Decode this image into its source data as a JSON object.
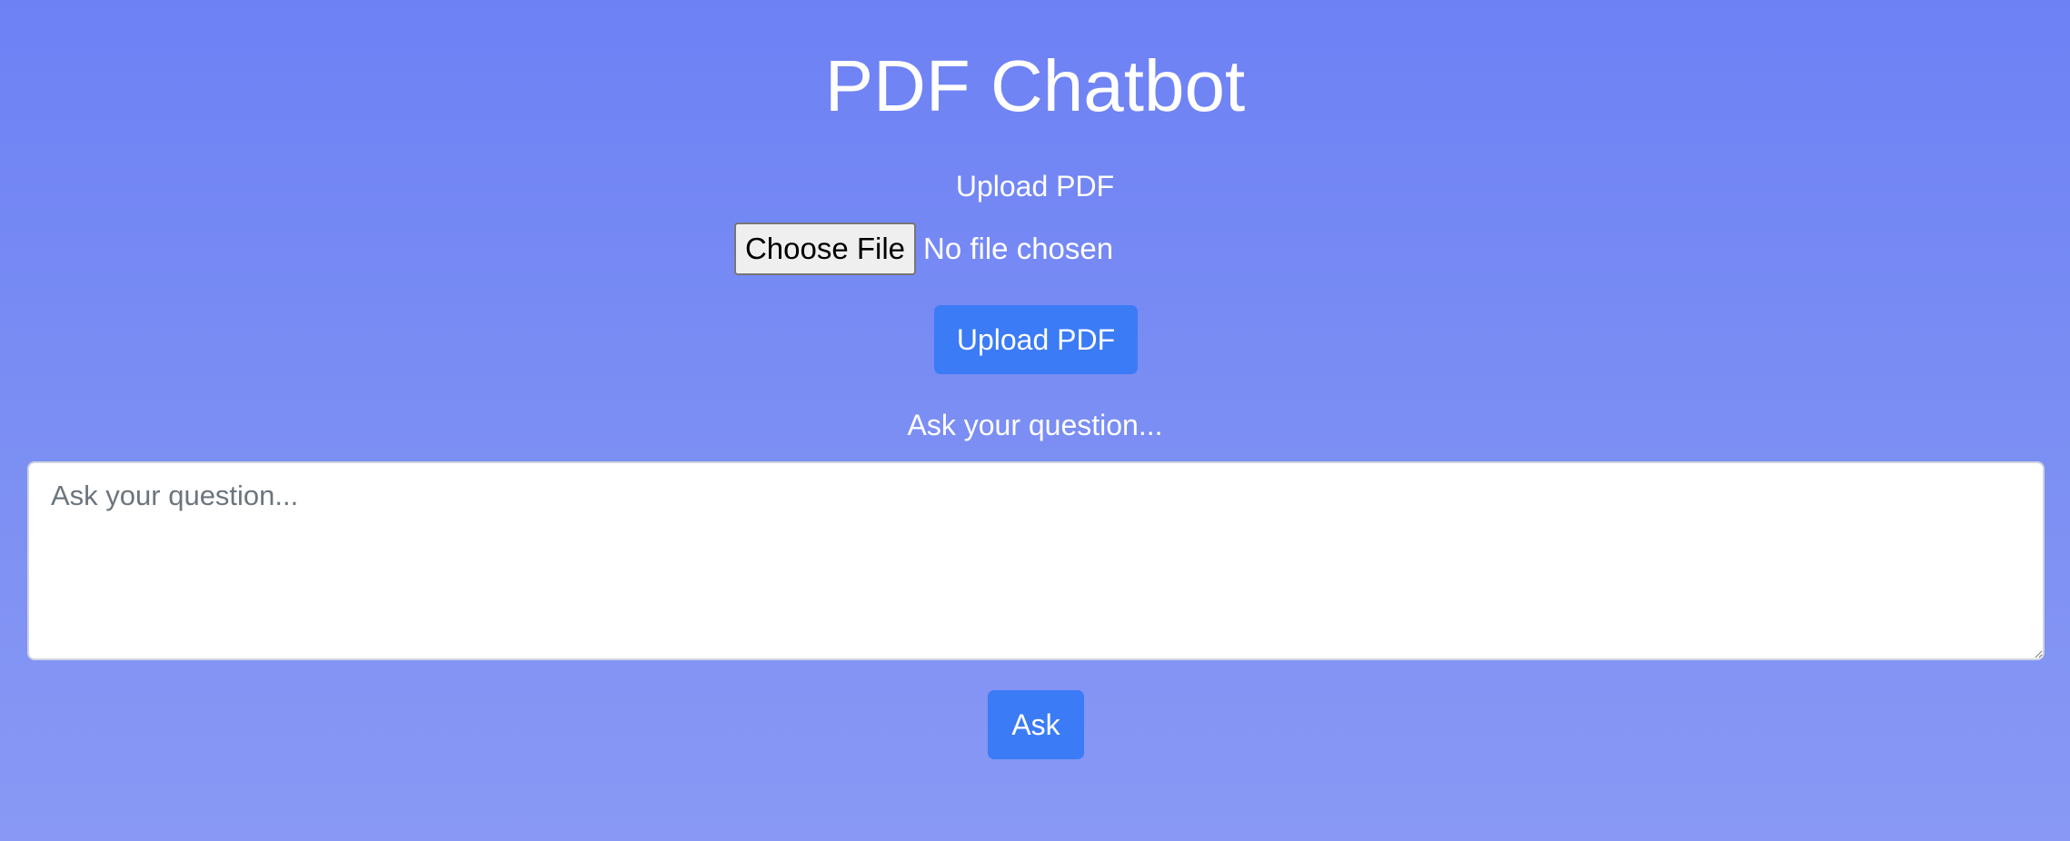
{
  "page": {
    "title": "PDF Chatbot"
  },
  "upload": {
    "label": "Upload PDF",
    "choose_file_label": "Choose File",
    "file_status": "No file chosen",
    "button_label": "Upload PDF"
  },
  "question": {
    "label": "Ask your question...",
    "placeholder": "Ask your question...",
    "value": "",
    "button_label": "Ask"
  },
  "colors": {
    "background_top": "#6d81f5",
    "background_bottom": "#8898f4",
    "primary_button": "#3b7bf6",
    "text": "#ffffff"
  }
}
